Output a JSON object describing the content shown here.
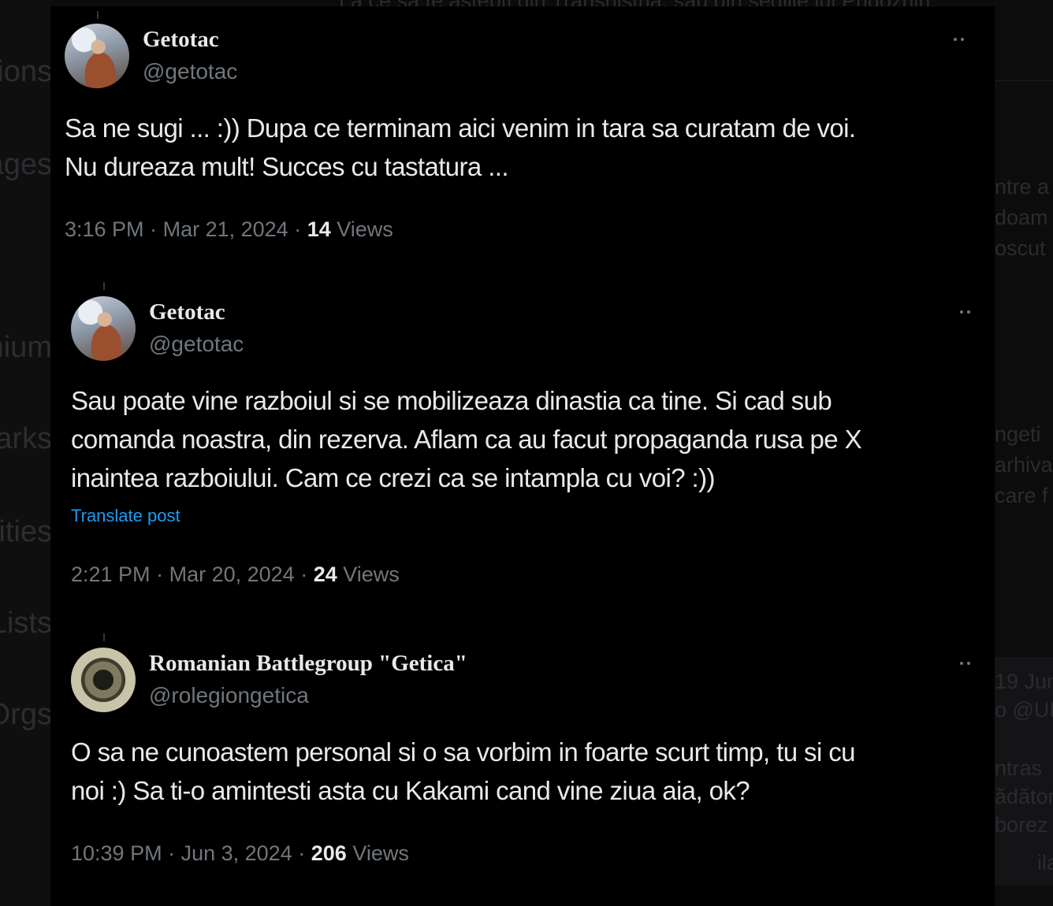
{
  "background": {
    "left_nav": [
      {
        "label": "Notifications"
      },
      {
        "label": "Messages"
      },
      {
        "label": "Premium"
      },
      {
        "label": "Bookmarks"
      },
      {
        "label": "Communities"
      },
      {
        "label": "Lists"
      },
      {
        "label": "Verified Orgs"
      }
    ],
    "top_text": "La ce să te aștepți din Transnistria, sau din sediile lui Prigozhin.",
    "right_text": [
      {
        "label": "ntre a"
      },
      {
        "label": "doam"
      },
      {
        "label": "oscut"
      },
      {
        "label": "ngeti"
      },
      {
        "label": "arhiva"
      },
      {
        "label": "care f"
      },
      {
        "label": "19 Jun"
      },
      {
        "label": "o @UK"
      },
      {
        "label": "ntras"
      },
      {
        "label": "ădător"
      },
      {
        "label": "borez"
      },
      {
        "label": "ila"
      }
    ]
  },
  "tweets": [
    {
      "display_name": "Getotac",
      "handle": "@getotac",
      "text_lines": [
        "Sa ne sugi ... :)) Dupa ce terminam aici venim in tara sa curatam de voi.",
        "Nu dureaza mult! Succes cu tastatura ..."
      ],
      "translate_label": "",
      "time": "3:16 PM",
      "date": "Mar 21, 2024",
      "views_count": "14",
      "views_label": "Views",
      "avatar_icon": "profile-photo"
    },
    {
      "display_name": "Getotac",
      "handle": "@getotac",
      "text_lines": [
        "Sau poate vine razboiul si se mobilizeaza dinastia ca tine. Si cad sub",
        "comanda noastra, din rezerva. Aflam ca au facut propaganda rusa pe X",
        "inaintea razboiului. Cam ce crezi ca se intampla cu voi? :))"
      ],
      "translate_label": "Translate post",
      "time": "2:21 PM",
      "date": "Mar 20, 2024",
      "views_count": "24",
      "views_label": "Views",
      "avatar_icon": "profile-photo"
    },
    {
      "display_name": "Romanian Battlegroup \"Getica\"",
      "handle": "@rolegiongetica",
      "text_lines": [
        "O sa ne cunoastem personal si o sa vorbim in foarte scurt timp, tu si cu",
        "noi :) Sa ti-o amintesti asta cu Kakami cand vine ziua aia, ok?"
      ],
      "translate_label": "",
      "time": "10:39 PM",
      "date": "Jun 3, 2024",
      "views_count": "206",
      "views_label": "Views",
      "avatar_icon": "emblem-logo"
    }
  ],
  "colors": {
    "text_primary": "#e7e9ea",
    "text_secondary": "#71767b",
    "link": "#1d9bf0",
    "background": "#000000"
  }
}
